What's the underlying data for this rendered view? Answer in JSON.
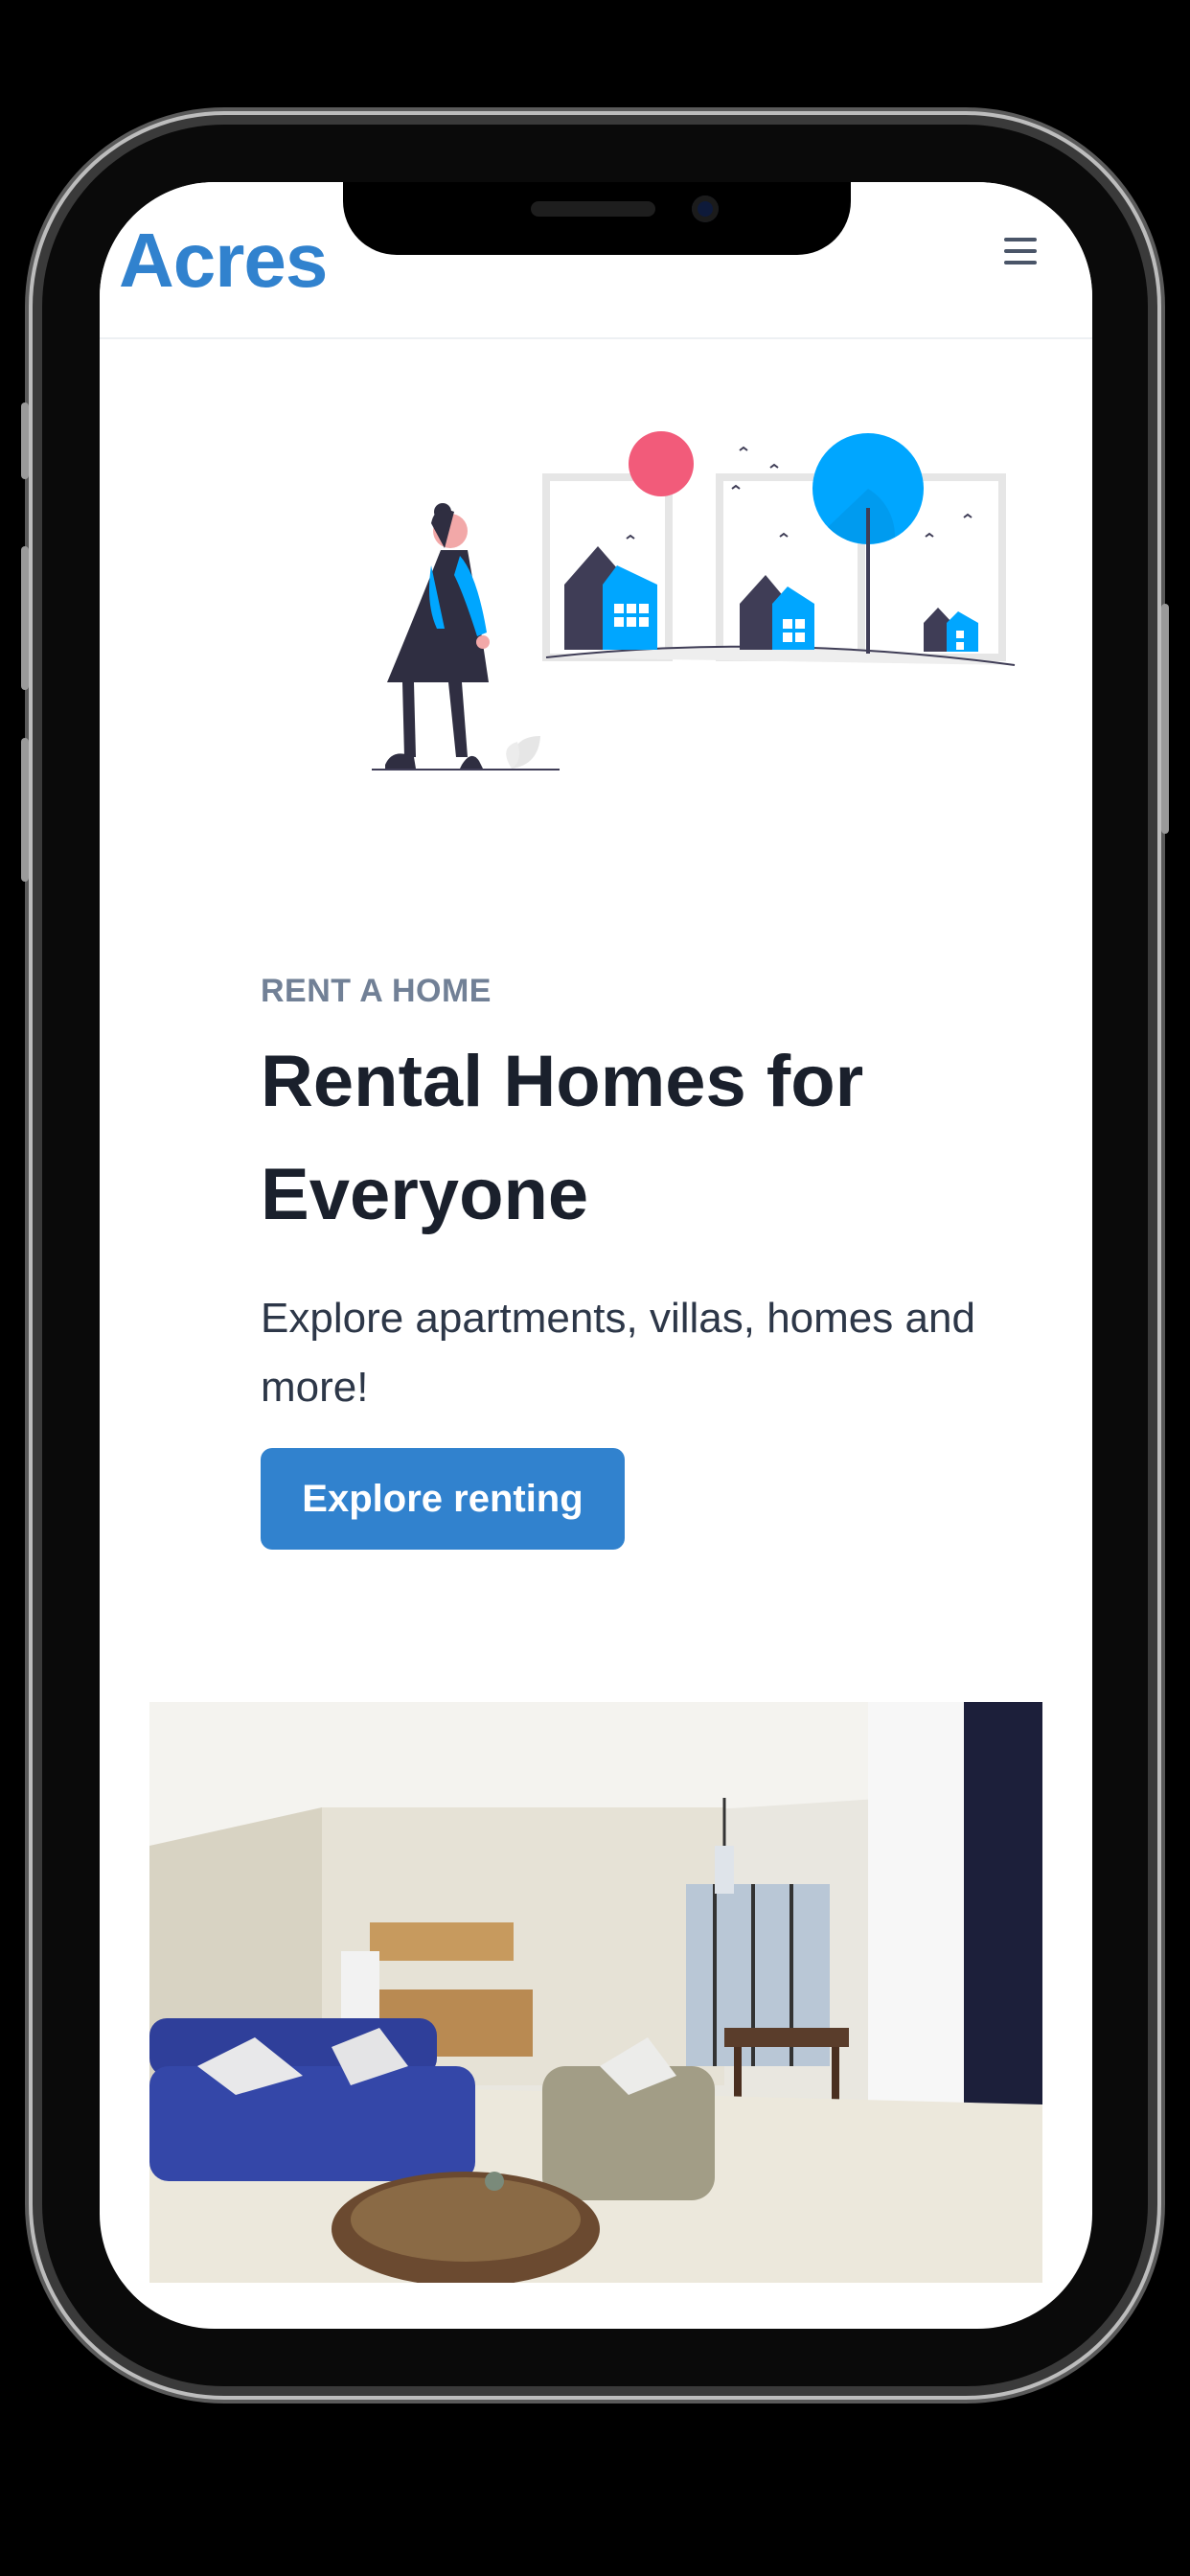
{
  "navbar": {
    "logo": "Acres",
    "menu_icon": "hamburger-menu-icon"
  },
  "hero": {
    "eyebrow": "RENT A HOME",
    "headline": "Rental Homes for Everyone",
    "subtext": "Explore apartments, villas, homes and more!",
    "cta_label": "Explore renting"
  },
  "colors": {
    "brand": "#3182ce",
    "heading": "#1a202c",
    "muted": "#718096",
    "accent_blue": "#00a6ff",
    "accent_pink": "#f25b7a"
  }
}
